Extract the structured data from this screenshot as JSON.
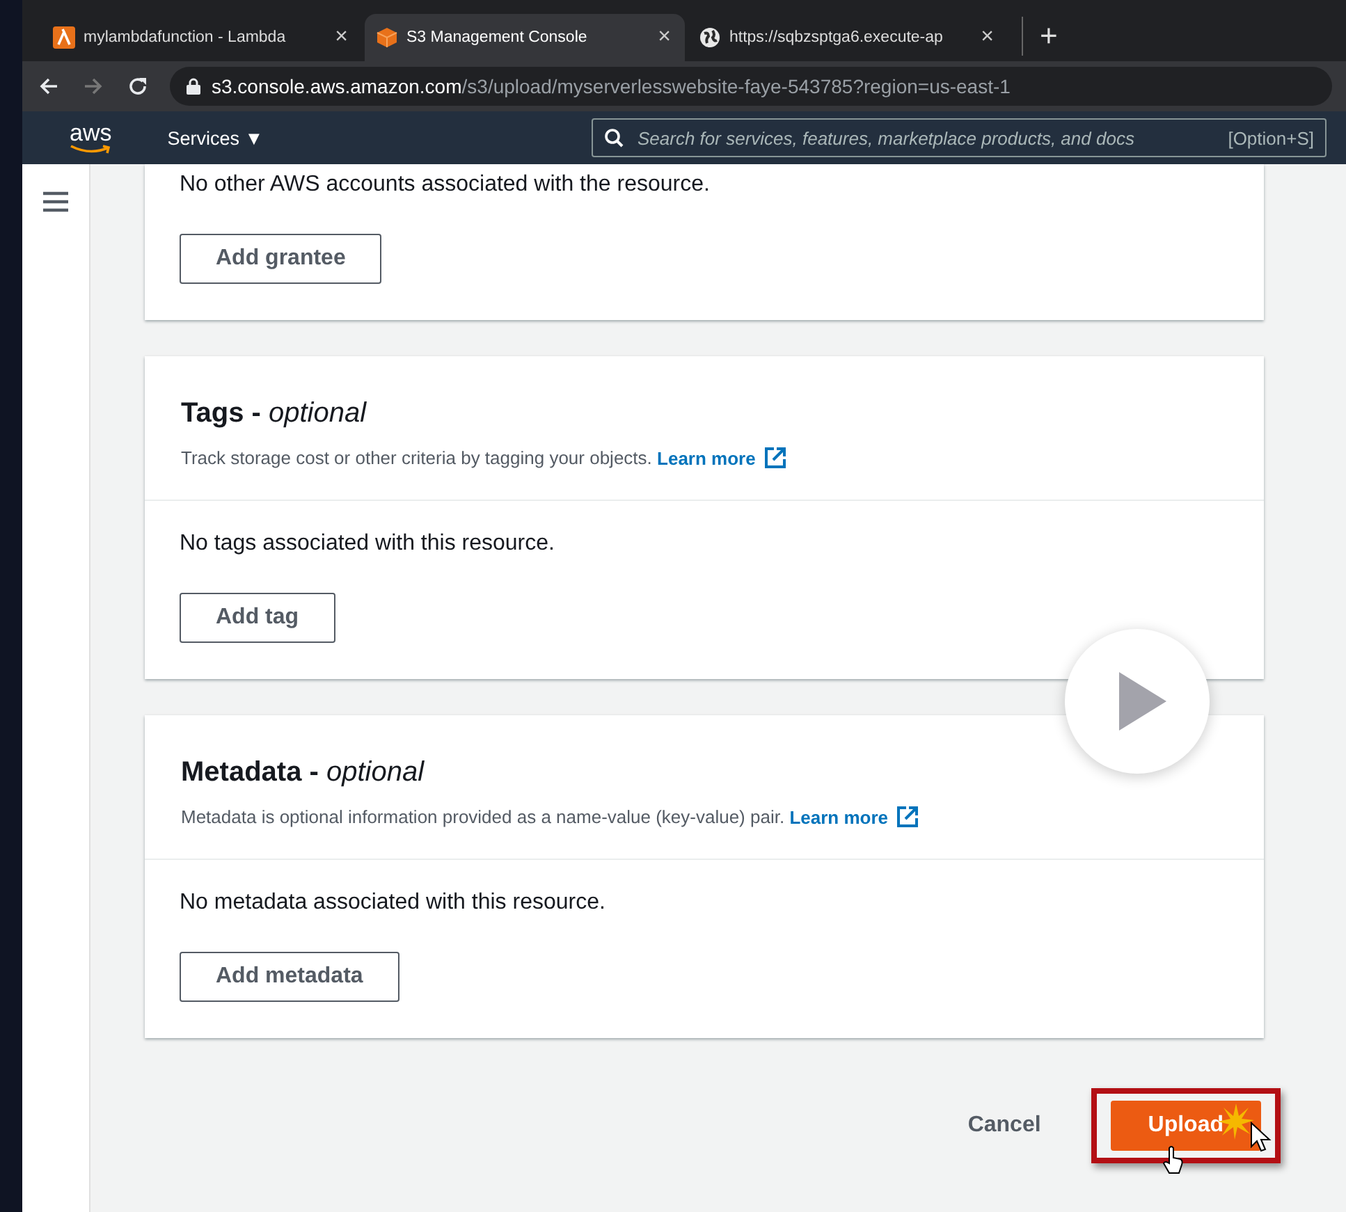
{
  "browser": {
    "tabs": [
      {
        "kind": "lambda",
        "title": "mylambdafunction - Lambda",
        "close": "×",
        "selected": false
      },
      {
        "kind": "s3",
        "title": "S3 Management Console",
        "close": "×",
        "selected": true
      },
      {
        "kind": "globe",
        "title": "https://sqbzsptga6.execute-ap",
        "close": "×",
        "selected": false
      }
    ],
    "new_tab": "+",
    "address": {
      "host": "s3.console.aws.amazon.com",
      "path": "/s3/upload/myserverlesswebsite-faye-543785?region=us-east-1"
    }
  },
  "nav": {
    "logo": "aws",
    "services": "Services ▼",
    "search": {
      "placeholder": "Search for services, features, marketplace products, and docs",
      "shortcut": "[Option+S]"
    }
  },
  "sections": [
    {
      "empty_text": "No other AWS accounts associated with the resource.",
      "button": "Add grantee"
    },
    {
      "title": "Tags - ",
      "optional": "optional",
      "description": "Track storage cost or other criteria by tagging your objects.",
      "link": "Learn more",
      "empty_text": "No tags associated with this resource.",
      "button": "Add tag"
    },
    {
      "title": "Metadata - ",
      "optional": "optional",
      "description": "Metadata is optional information provided as a name-value (key-value) pair.",
      "link": "Learn more",
      "empty_text": "No metadata associated with this resource.",
      "button": "Add metadata"
    }
  ],
  "footer": {
    "cancel": "Cancel",
    "upload": "Upload"
  }
}
